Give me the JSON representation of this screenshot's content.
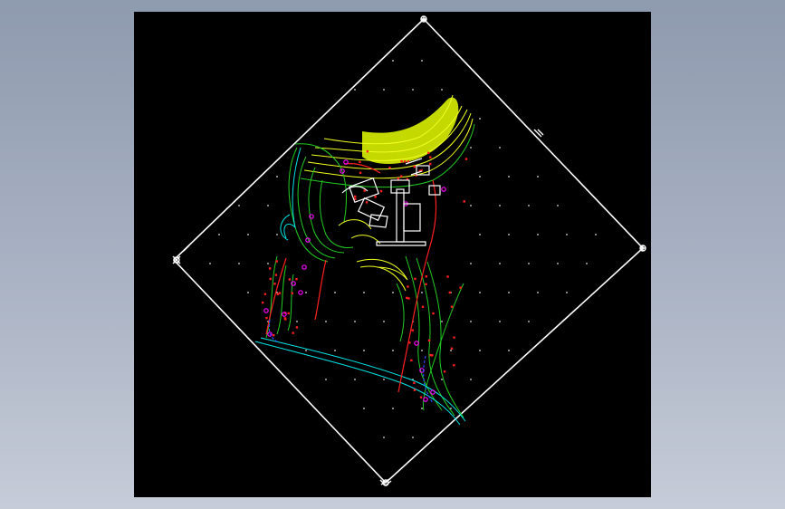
{
  "window": {
    "background_top": "#8e9aae",
    "background_bottom": "#c6ccd8"
  },
  "drawing": {
    "background": "#000000",
    "frame_color": "#ffffff",
    "colors": {
      "terrain_fill": "#e6ff00",
      "contour_yellow": "#f0ff20",
      "contour_green": "#22cc22",
      "contour_cyan": "#00e5e5",
      "boundary_red": "#ff2020",
      "marker_magenta": "#ff00ff",
      "building_white": "#ffffff",
      "point_white": "#dddddd",
      "route_blue": "#2a4bff"
    },
    "icons": [
      "frame-corner-marker-icon",
      "survey-point-icon",
      "crosshair-icon"
    ]
  }
}
